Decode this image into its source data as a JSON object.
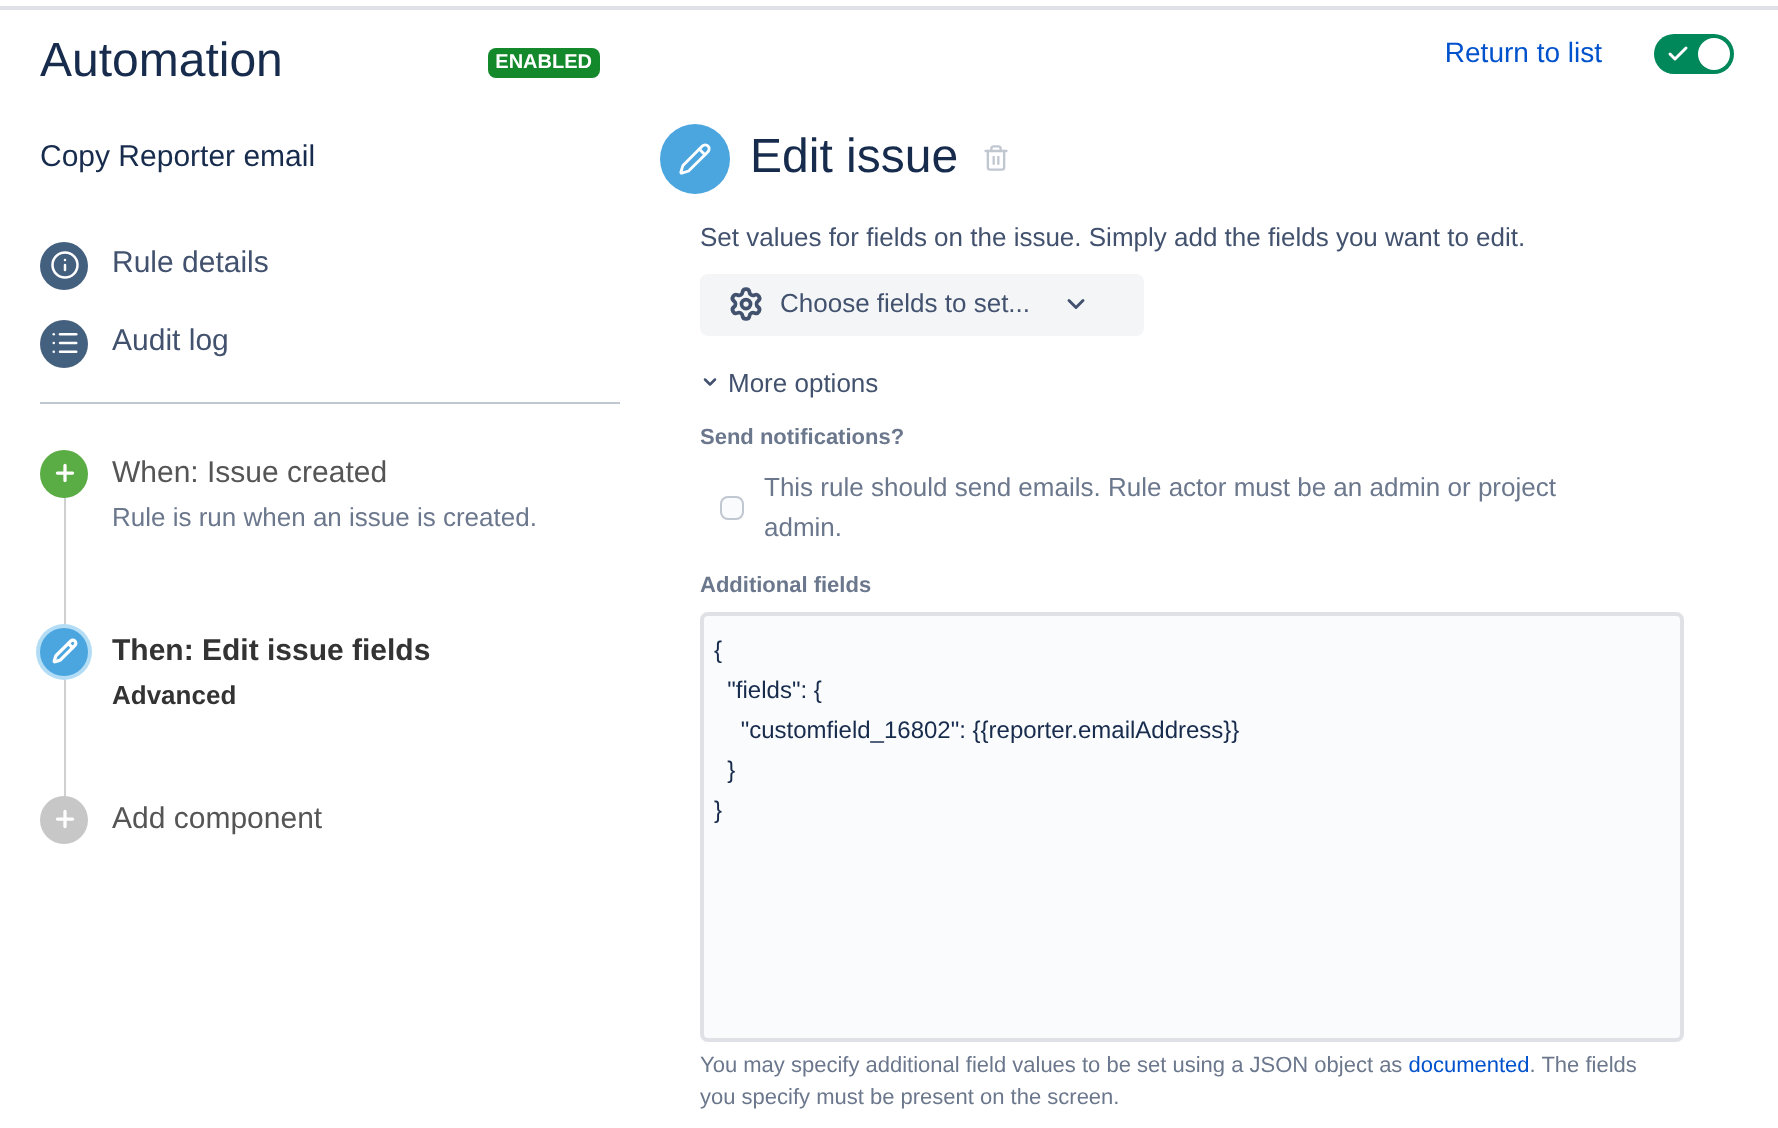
{
  "header": {
    "title": "Automation",
    "status_badge": "ENABLED",
    "return_link": "Return to list",
    "rule_toggle": {
      "on": true
    }
  },
  "sidebar": {
    "rule_name": "Copy Reporter email",
    "nav_items": [
      {
        "label": "Rule details",
        "kind": "info"
      },
      {
        "label": "Audit log",
        "kind": "log"
      }
    ],
    "steps": [
      {
        "kind": "trigger",
        "title": "When: Issue created",
        "subtitle": "Rule is run when an issue is created.",
        "selected": false
      },
      {
        "kind": "action",
        "title": "Then: Edit issue fields",
        "subtitle": "Advanced",
        "selected": true
      },
      {
        "kind": "add",
        "title": "Add component",
        "selected": false
      }
    ]
  },
  "editor": {
    "title": "Edit issue",
    "description": "Set values for fields on the issue. Simply add the fields you want to edit.",
    "choose_fields": "Choose fields to set...",
    "more_options": {
      "label": "More options",
      "expanded": true
    },
    "send_notifications": {
      "label": "Send notifications?",
      "checkbox_label": "This rule should send emails. Rule actor must be an admin or project admin.",
      "checked": false
    },
    "additional_fields": {
      "label": "Additional fields",
      "value": "{\n  \"fields\": {\n    \"customfield_16802\": {{reporter.emailAddress}}\n  }\n}",
      "help_before": "You may specify additional field values to be set using a JSON object as",
      "help_link": "documented",
      "help_after": ". The fields you specify must be present on the screen."
    }
  }
}
